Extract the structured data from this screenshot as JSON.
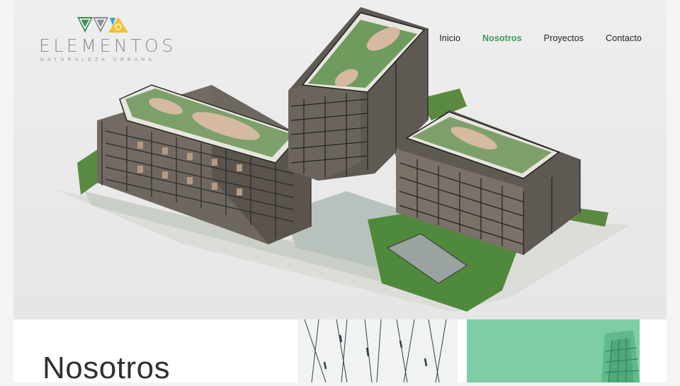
{
  "brand": {
    "name": "ELEMENTOS",
    "tagline": "NATURALEZA URBANA"
  },
  "nav": {
    "items": [
      {
        "label": "Inicio",
        "active": false
      },
      {
        "label": "Nosotros",
        "active": true
      },
      {
        "label": "Proyectos",
        "active": false
      },
      {
        "label": "Contacto",
        "active": false
      }
    ],
    "active_color": "#3a9a52"
  },
  "hero": {
    "image": "isometric-building-render"
  },
  "section": {
    "title": "Nosotros"
  },
  "colors": {
    "background": "#f3f3f3",
    "text": "#222222",
    "accent_green": "#3a9a52",
    "thumb_green": "#7fcda4"
  }
}
